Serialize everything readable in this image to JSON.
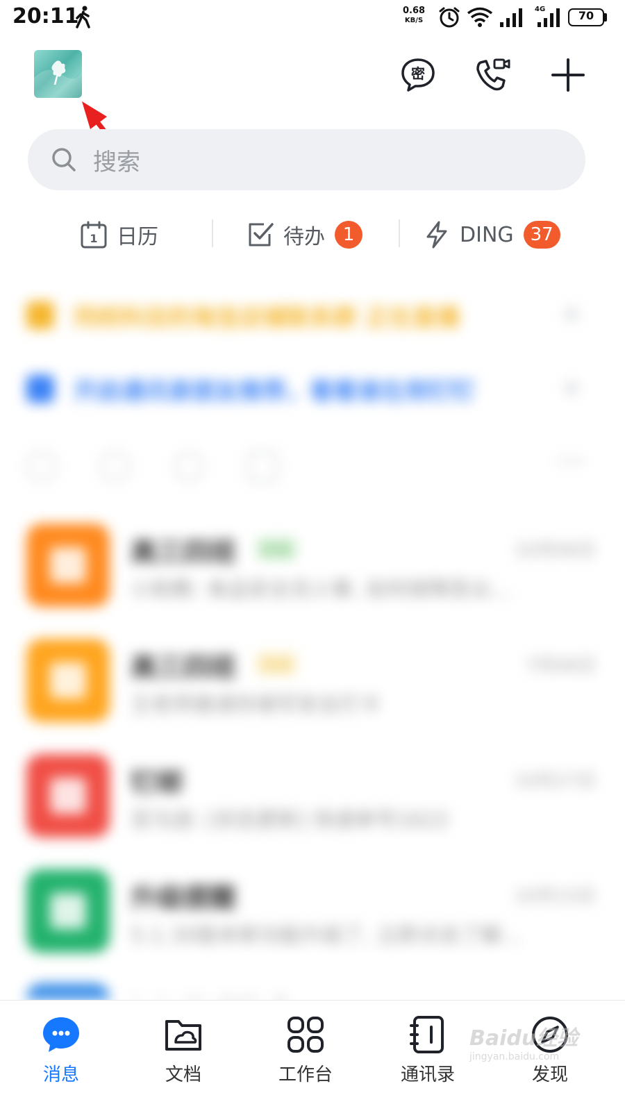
{
  "status_bar": {
    "time": "20:11",
    "net_speed_value": "0.68",
    "net_speed_unit": "KB/S",
    "network_type": "4G",
    "battery": "70",
    "battery_level": 0.7
  },
  "header": {
    "avatar_icon": "user-avatar",
    "secret_chat_glyph": "密",
    "icons": [
      "secret-chat-icon",
      "video-call-icon",
      "add-icon"
    ]
  },
  "search": {
    "placeholder": "搜索"
  },
  "quick_actions": {
    "calendar": {
      "label": "日历",
      "icon": "calendar-icon",
      "calendar_day": "1"
    },
    "todo": {
      "label": "待办",
      "badge": "1",
      "icon": "checkbox-icon"
    },
    "ding": {
      "label": "DING",
      "badge": "37",
      "icon": "lightning-icon"
    }
  },
  "blurred_notices": [
    {
      "text": "同校科目的淘宝店铺联系群 正在直播",
      "color": "#f5b62c"
    },
    {
      "text": "开启通讯录朋友推荐，看看谁在用钉钉",
      "color": "#3b82f6"
    }
  ],
  "chat_list": [
    {
      "name": "高三四班",
      "tag": "班级",
      "time": "10月06日",
      "preview": "小助教: 食品安全无小事, 如何保障吾尖...",
      "avatar_color": "#ff8a1f",
      "tag_color": "#5cb85c"
    },
    {
      "name": "高三四班",
      "tag": "班级",
      "time": "7月06日",
      "preview": "王老师邀请你填写安全打卡",
      "avatar_color": "#ffa51f",
      "tag_color": "#f0c040"
    },
    {
      "name": "钉邮",
      "tag": "",
      "time": "10月27日",
      "preview": "亚马逊: [状态更新] 快递单号1622",
      "avatar_color": "#f04e45",
      "tag_color": ""
    },
    {
      "name": "升级提醒",
      "tag": "",
      "time": "10月15日",
      "preview": "5.1.30版本新功能升级了, 立即点击了解...",
      "avatar_color": "#23b26d",
      "tag_color": ""
    },
    {
      "name": "钉钉管理助手",
      "tag": "",
      "time": "",
      "preview": "",
      "avatar_color": "#3b8fe8",
      "tag_color": ""
    }
  ],
  "bottom_nav": [
    {
      "label": "消息",
      "icon": "message-icon",
      "active": true
    },
    {
      "label": "文档",
      "icon": "document-folder-icon",
      "active": false
    },
    {
      "label": "工作台",
      "icon": "workbench-grid-icon",
      "active": false
    },
    {
      "label": "通讯录",
      "icon": "contacts-icon",
      "active": false
    },
    {
      "label": "发现",
      "icon": "compass-icon",
      "active": false
    }
  ],
  "watermark": {
    "brand": "Baidu经验",
    "url": "jingyan.baidu.com"
  },
  "colors": {
    "accent": "#1677ff",
    "badge": "#f25b2c",
    "arrow": "#e8201f"
  }
}
